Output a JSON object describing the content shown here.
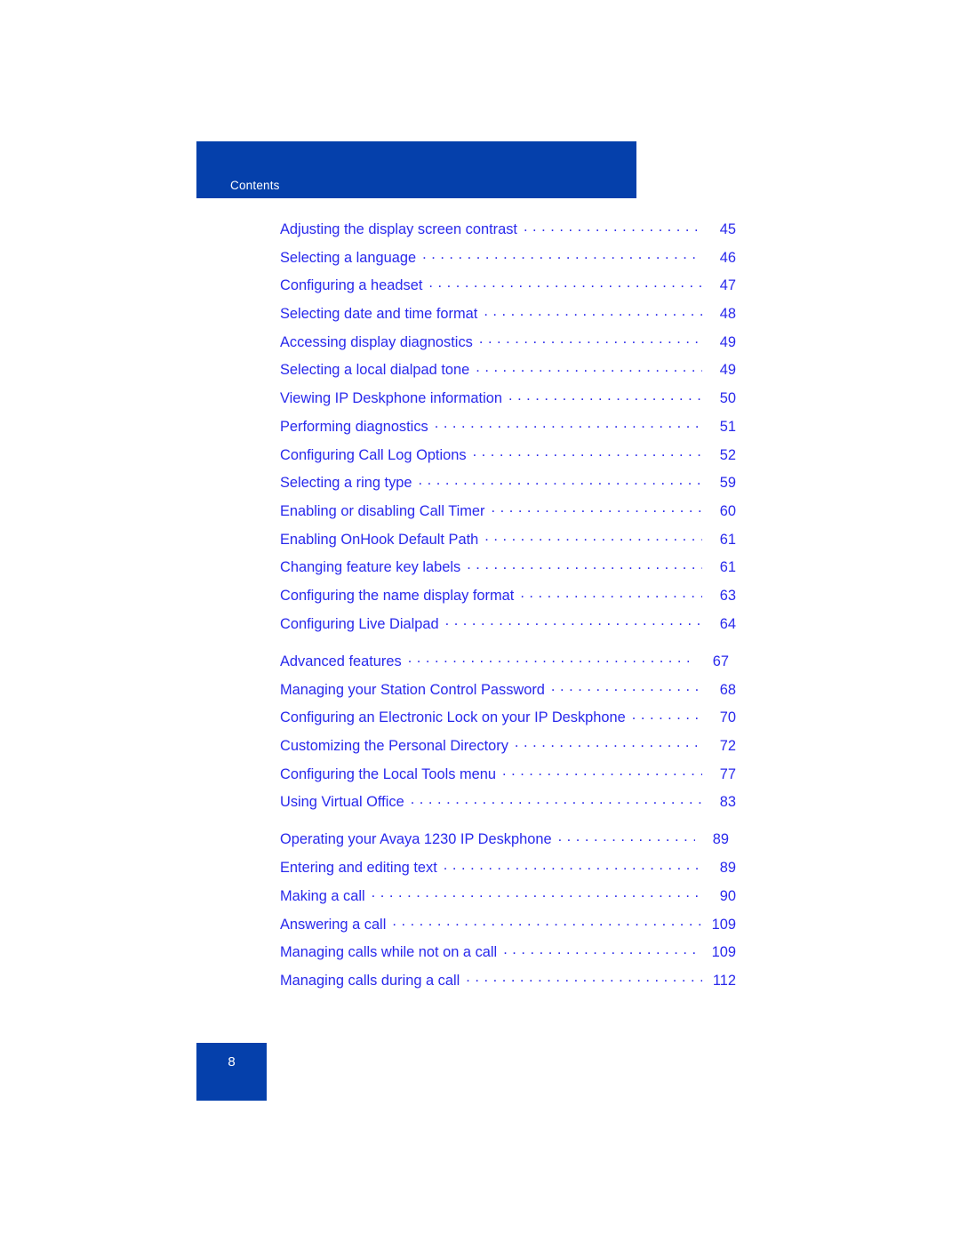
{
  "header": {
    "title": "Contents",
    "band_color": "#0540ab"
  },
  "colors": {
    "banner_blue": "#0540ab",
    "link_blue": "#2929ec",
    "page_background": "#ffffff",
    "header_text": "#ffffff"
  },
  "toc": {
    "entries": [
      {
        "label": "Adjusting the display screen contrast",
        "page": "45",
        "level": "item"
      },
      {
        "label": "Selecting a language",
        "page": "46",
        "level": "item"
      },
      {
        "label": "Configuring a headset",
        "page": "47",
        "level": "item"
      },
      {
        "label": "Selecting date and time format",
        "page": "48",
        "level": "item"
      },
      {
        "label": "Accessing display diagnostics",
        "page": "49",
        "level": "item"
      },
      {
        "label": "Selecting a local dialpad tone",
        "page": "49",
        "level": "item"
      },
      {
        "label": "Viewing IP Deskphone information",
        "page": "50",
        "level": "item"
      },
      {
        "label": "Performing diagnostics",
        "page": "51",
        "level": "item"
      },
      {
        "label": "Configuring Call Log Options",
        "page": "52",
        "level": "item"
      },
      {
        "label": "Selecting a ring type",
        "page": "59",
        "level": "item"
      },
      {
        "label": "Enabling or disabling Call Timer",
        "page": "60",
        "level": "item"
      },
      {
        "label": "Enabling OnHook Default Path",
        "page": "61",
        "level": "item"
      },
      {
        "label": "Changing feature key labels",
        "page": "61",
        "level": "item"
      },
      {
        "label": "Configuring the name display format",
        "page": "63",
        "level": "item"
      },
      {
        "label": "Configuring Live Dialpad",
        "page": "64",
        "level": "item"
      },
      {
        "label": "Advanced features",
        "page": "67",
        "level": "section"
      },
      {
        "label": "Managing your Station Control Password",
        "page": "68",
        "level": "item"
      },
      {
        "label": "Configuring an Electronic Lock on your IP Deskphone",
        "page": "70",
        "level": "item"
      },
      {
        "label": "Customizing the Personal Directory",
        "page": "72",
        "level": "item"
      },
      {
        "label": "Configuring the Local Tools menu",
        "page": "77",
        "level": "item"
      },
      {
        "label": "Using Virtual Office",
        "page": "83",
        "level": "item"
      },
      {
        "label": "Operating your Avaya 1230 IP Deskphone",
        "page": "89",
        "level": "section"
      },
      {
        "label": "Entering and editing text",
        "page": "89",
        "level": "item"
      },
      {
        "label": "Making a call",
        "page": "90",
        "level": "item"
      },
      {
        "label": "Answering a call",
        "page": "109",
        "level": "item"
      },
      {
        "label": "Managing calls while not on a call",
        "page": "109",
        "level": "item"
      },
      {
        "label": "Managing calls during a call",
        "page": "112",
        "level": "item"
      }
    ]
  },
  "footer": {
    "page_number": "8"
  }
}
